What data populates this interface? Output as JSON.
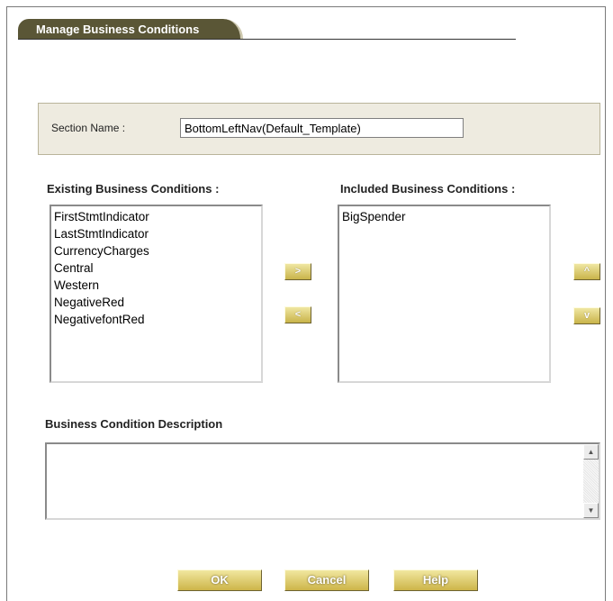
{
  "tab": {
    "title": "Manage Business Conditions"
  },
  "section": {
    "label": "Section Name :",
    "value": "BottomLeftNav(Default_Template)"
  },
  "existing": {
    "heading": "Existing Business Conditions :",
    "items": [
      "FirstStmtIndicator",
      "LastStmtIndicator",
      "CurrencyCharges",
      "Central",
      "Western",
      "NegativeRed",
      "NegativefontRed"
    ]
  },
  "included": {
    "heading": "Included Business Conditions :",
    "items": [
      "BigSpender"
    ]
  },
  "transfer": {
    "add_label": ">",
    "remove_label": "<"
  },
  "order": {
    "up_label": "^",
    "down_label": "v"
  },
  "description": {
    "heading": "Business Condition Description",
    "value": ""
  },
  "scroll": {
    "up_glyph": "▲",
    "down_glyph": "▼"
  },
  "footer": {
    "ok_label": "OK",
    "cancel_label": "Cancel",
    "help_label": "Help"
  },
  "colors": {
    "tab_bg": "#5a5636",
    "panel_bg": "#eeebe0",
    "button_gold": "#cdb549"
  }
}
